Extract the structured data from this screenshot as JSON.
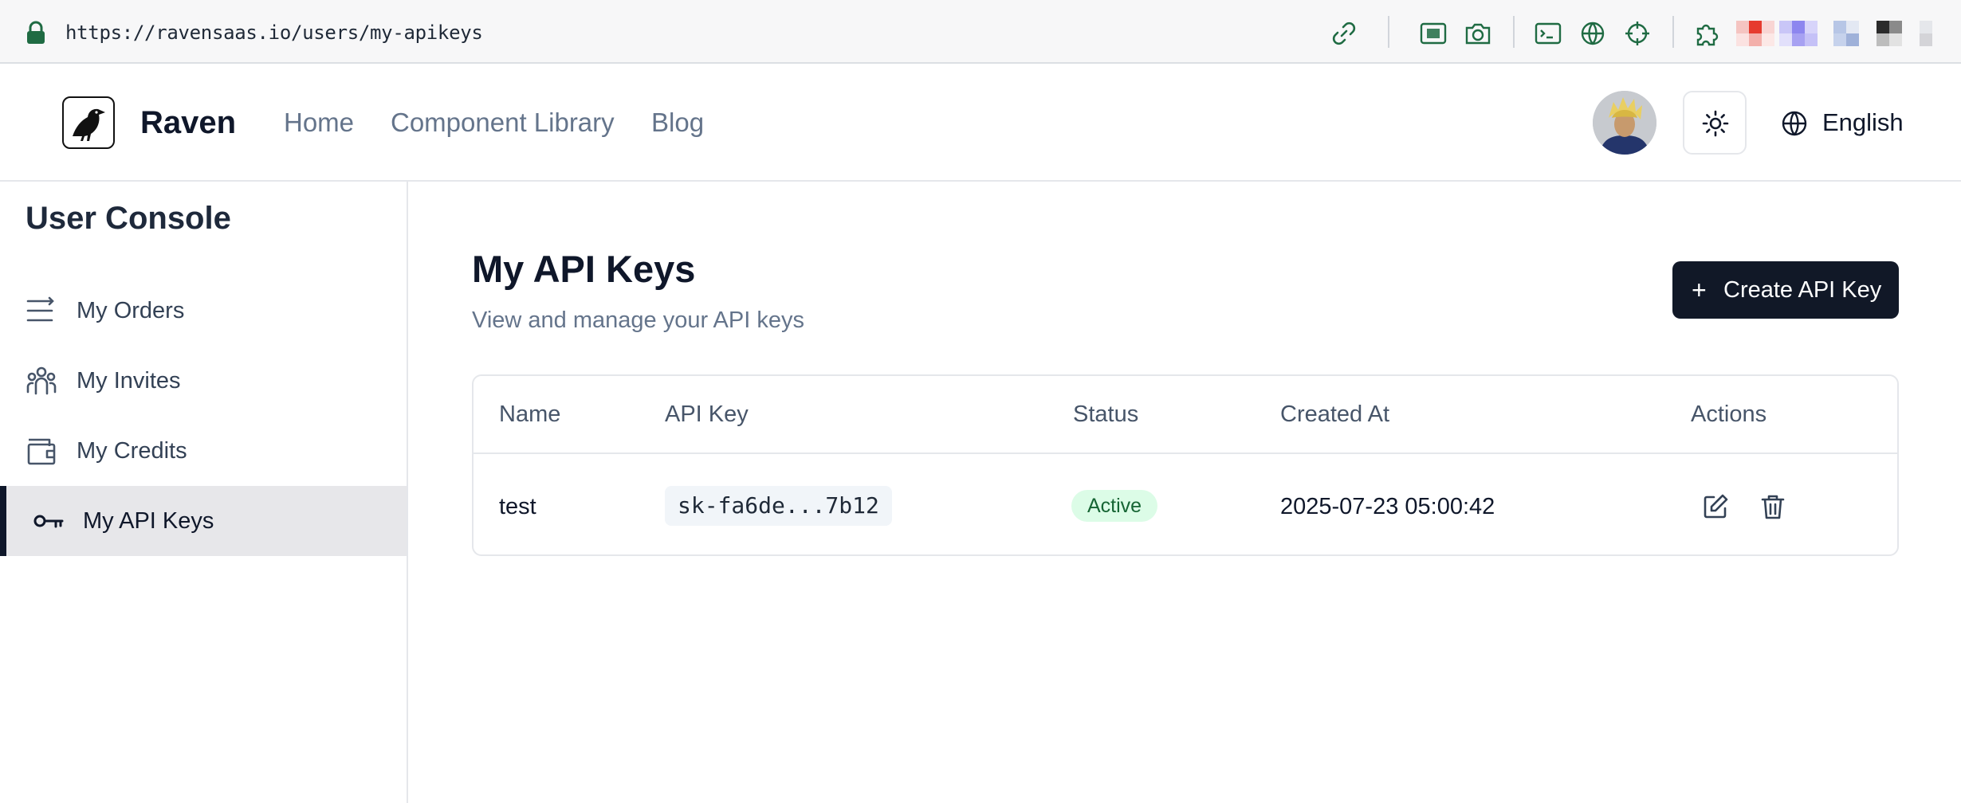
{
  "browser": {
    "url": "https://ravensaas.io/users/my-apikeys",
    "icons": [
      "lock-icon",
      "link-icon",
      "screenshot-icon",
      "camera-icon",
      "terminal-icon",
      "globe-icon",
      "crosshair-icon",
      "extension-icon"
    ]
  },
  "header": {
    "brand": "Raven",
    "nav": {
      "home": "Home",
      "components": "Component Library",
      "blog": "Blog"
    },
    "language": "English"
  },
  "sidebar": {
    "title": "User Console",
    "items": [
      {
        "label": "My Orders",
        "icon": "list-icon"
      },
      {
        "label": "My Invites",
        "icon": "users-icon"
      },
      {
        "label": "My Credits",
        "icon": "wallet-icon"
      },
      {
        "label": "My API Keys",
        "icon": "key-icon",
        "active": true
      }
    ]
  },
  "main": {
    "title": "My API Keys",
    "subtitle": "View and manage your API keys",
    "create_button": "Create API Key",
    "table": {
      "headers": {
        "name": "Name",
        "key": "API Key",
        "status": "Status",
        "created": "Created At",
        "actions": "Actions"
      },
      "rows": [
        {
          "name": "test",
          "key": "sk-fa6de...7b12",
          "status": "Active",
          "created": "2025-07-23 05:00:42"
        }
      ]
    }
  },
  "colors": {
    "accent": "#111827",
    "status_active_bg": "#dcfce7",
    "status_active_text": "#166534",
    "extension_green": "#1f6b43"
  }
}
